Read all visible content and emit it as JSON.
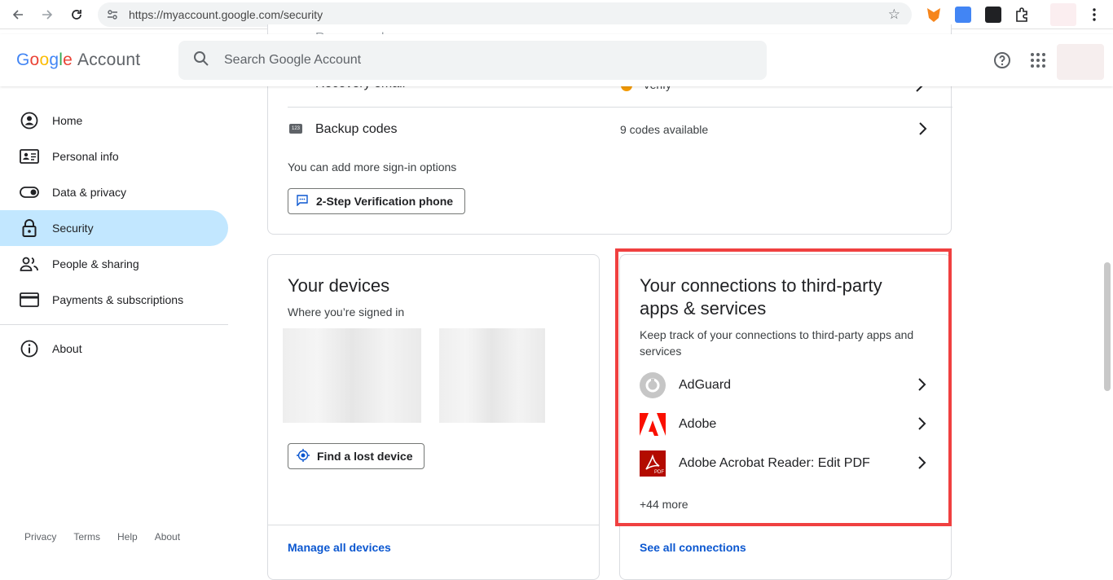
{
  "browser": {
    "url": "https://myaccount.google.com/security"
  },
  "header": {
    "logo_google": "Google",
    "logo_account": "Account",
    "search_placeholder": "Search Google Account"
  },
  "sidebar": {
    "items": [
      {
        "label": "Home",
        "icon": "account-circle-icon"
      },
      {
        "label": "Personal info",
        "icon": "id-card-icon"
      },
      {
        "label": "Data & privacy",
        "icon": "toggle-icon"
      },
      {
        "label": "Security",
        "icon": "lock-icon",
        "active": true
      },
      {
        "label": "People & sharing",
        "icon": "people-icon"
      },
      {
        "label": "Payments & subscriptions",
        "icon": "credit-card-icon"
      }
    ],
    "about": "About",
    "footer": [
      "Privacy",
      "Terms",
      "Help",
      "About"
    ]
  },
  "signin_card": {
    "partial_row1_label": "Recovery phone",
    "partial_row2_label": "Recovery email",
    "partial_row2_value": "Verify",
    "backup_label": "Backup codes",
    "backup_value": "9 codes available",
    "more_options": "You can add more sign-in options",
    "two_step_button": "2-Step Verification phone"
  },
  "devices_card": {
    "title": "Your devices",
    "subtitle": "Where you’re signed in",
    "find_button": "Find a lost device",
    "manage_link": "Manage all devices"
  },
  "connections_card": {
    "title": "Your connections to third-party apps & services",
    "subtitle": "Keep track of your connections to third-party apps and services",
    "apps": [
      {
        "name": "AdGuard",
        "icon": "adguard-icon"
      },
      {
        "name": "Adobe",
        "icon": "adobe-icon"
      },
      {
        "name": "Adobe Acrobat Reader: Edit PDF",
        "icon": "acrobat-pdf-icon"
      }
    ],
    "more": "+44 more",
    "see_all_link": "See all connections"
  },
  "colors": {
    "active_nav": "#c2e7ff",
    "link": "#0b57d0",
    "highlight": "#f04040"
  }
}
